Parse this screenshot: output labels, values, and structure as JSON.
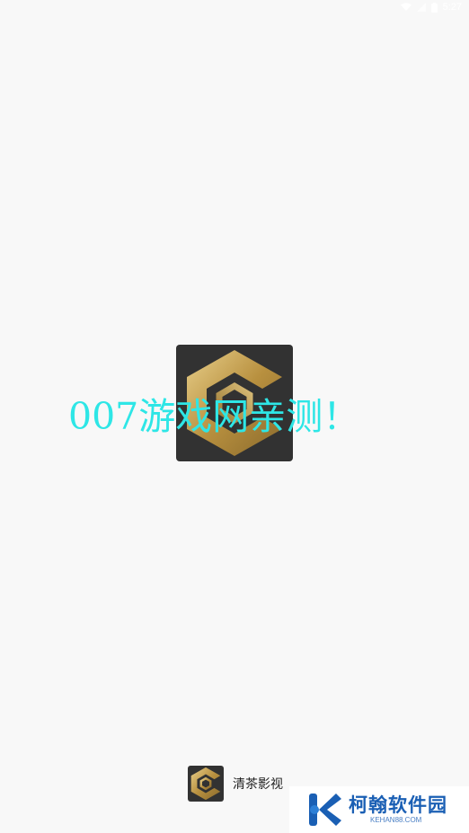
{
  "status_bar": {
    "time": "5:27",
    "icons": [
      "wifi-icon",
      "signal-icon",
      "battery-icon"
    ]
  },
  "splash": {
    "logo": "app-logo-c"
  },
  "watermark": {
    "text": "007游戏网亲测！",
    "color": "#2ee6e6"
  },
  "app_brand": {
    "name": "清茶影视"
  },
  "corner_watermark": {
    "title": "柯翰软件园",
    "domain": "KEHAN88.COM",
    "color": "#1a5fb4"
  },
  "colors": {
    "background": "#f8f8f8",
    "logo_bg": "#323232",
    "gold": "#c9a24e"
  }
}
